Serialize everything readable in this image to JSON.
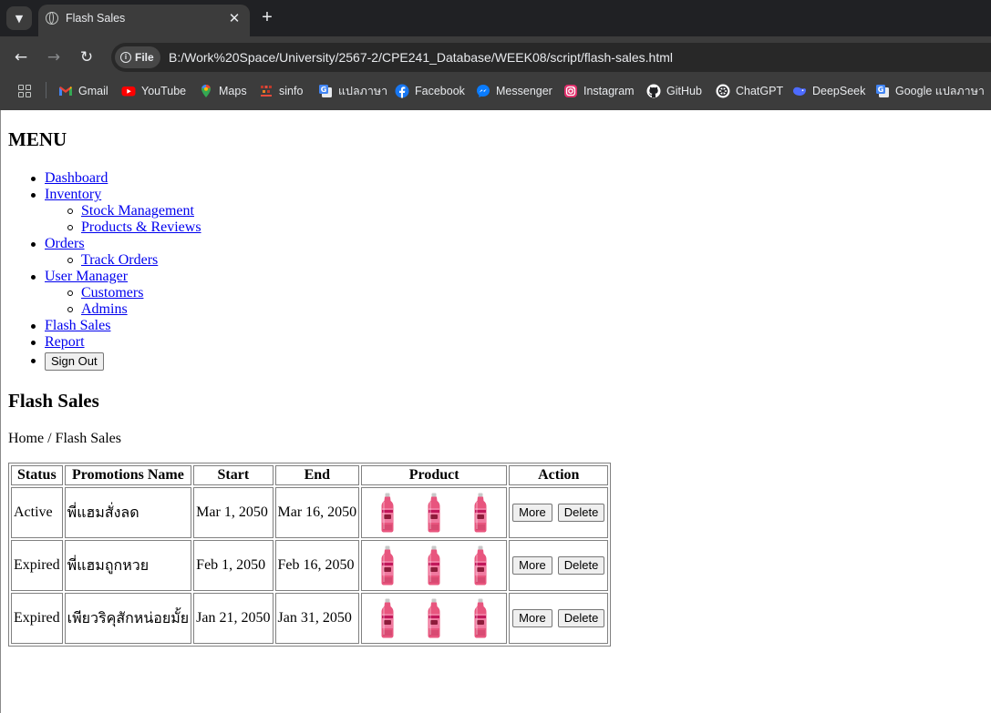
{
  "browser": {
    "tab_title": "Flash Sales",
    "file_chip": "File",
    "url": "B:/Work%20Space/University/2567-2/CPE241_Database/WEEK08/script/flash-sales.html",
    "bookmarks": [
      {
        "label": "Gmail",
        "icon": "gmail-icon",
        "color": "#ea4335"
      },
      {
        "label": "YouTube",
        "icon": "youtube-icon",
        "color": "#ff0000"
      },
      {
        "label": "Maps",
        "icon": "maps-icon",
        "color": "#34a853"
      },
      {
        "label": "sinfo",
        "icon": "sinfo-icon",
        "color": "#c0392b"
      },
      {
        "label": "แปลภาษา",
        "icon": "google-translate-icon",
        "color": "#4285f4"
      },
      {
        "label": "Facebook",
        "icon": "facebook-icon",
        "color": "#1877f2"
      },
      {
        "label": "Messenger",
        "icon": "messenger-icon",
        "color": "#0a7cff"
      },
      {
        "label": "Instagram",
        "icon": "instagram-icon",
        "color": "#e1306c"
      },
      {
        "label": "GitHub",
        "icon": "github-icon",
        "color": "#ffffff"
      },
      {
        "label": "ChatGPT",
        "icon": "chatgpt-icon",
        "color": "#ffffff"
      },
      {
        "label": "DeepSeek",
        "icon": "deepseek-icon",
        "color": "#4d6bfe"
      },
      {
        "label": "Google แปลภาษา",
        "icon": "google-translate-icon",
        "color": "#4285f4"
      }
    ]
  },
  "menu": {
    "title": "MENU",
    "items": [
      {
        "label": "Dashboard"
      },
      {
        "label": "Inventory",
        "children": [
          "Stock Management",
          "Products & Reviews"
        ]
      },
      {
        "label": "Orders",
        "children": [
          "Track Orders"
        ]
      },
      {
        "label": "User Manager",
        "children": [
          "Customers",
          "Admins"
        ]
      },
      {
        "label": "Flash Sales"
      },
      {
        "label": "Report"
      }
    ],
    "sign_out": "Sign Out"
  },
  "page": {
    "title": "Flash Sales",
    "breadcrumb": "Home / Flash Sales"
  },
  "table": {
    "headers": [
      "Status",
      "Promotions Name",
      "Start",
      "End",
      "Product",
      "Action"
    ],
    "rows": [
      {
        "status": "Active",
        "name": "พี่แฮมสั่งลด",
        "start": "Mar 1, 2050",
        "end": "Mar 16, 2050"
      },
      {
        "status": "Expired",
        "name": "พี่แฮมถูกหวย",
        "start": "Feb 1, 2050",
        "end": "Feb 16, 2050"
      },
      {
        "status": "Expired",
        "name": "เพียวริคุสักหน่อยมั้ย",
        "start": "Jan 21, 2050",
        "end": "Jan 31, 2050"
      }
    ],
    "more_label": "More",
    "delete_label": "Delete",
    "product_image": "pink-drink-bottle-icon"
  }
}
